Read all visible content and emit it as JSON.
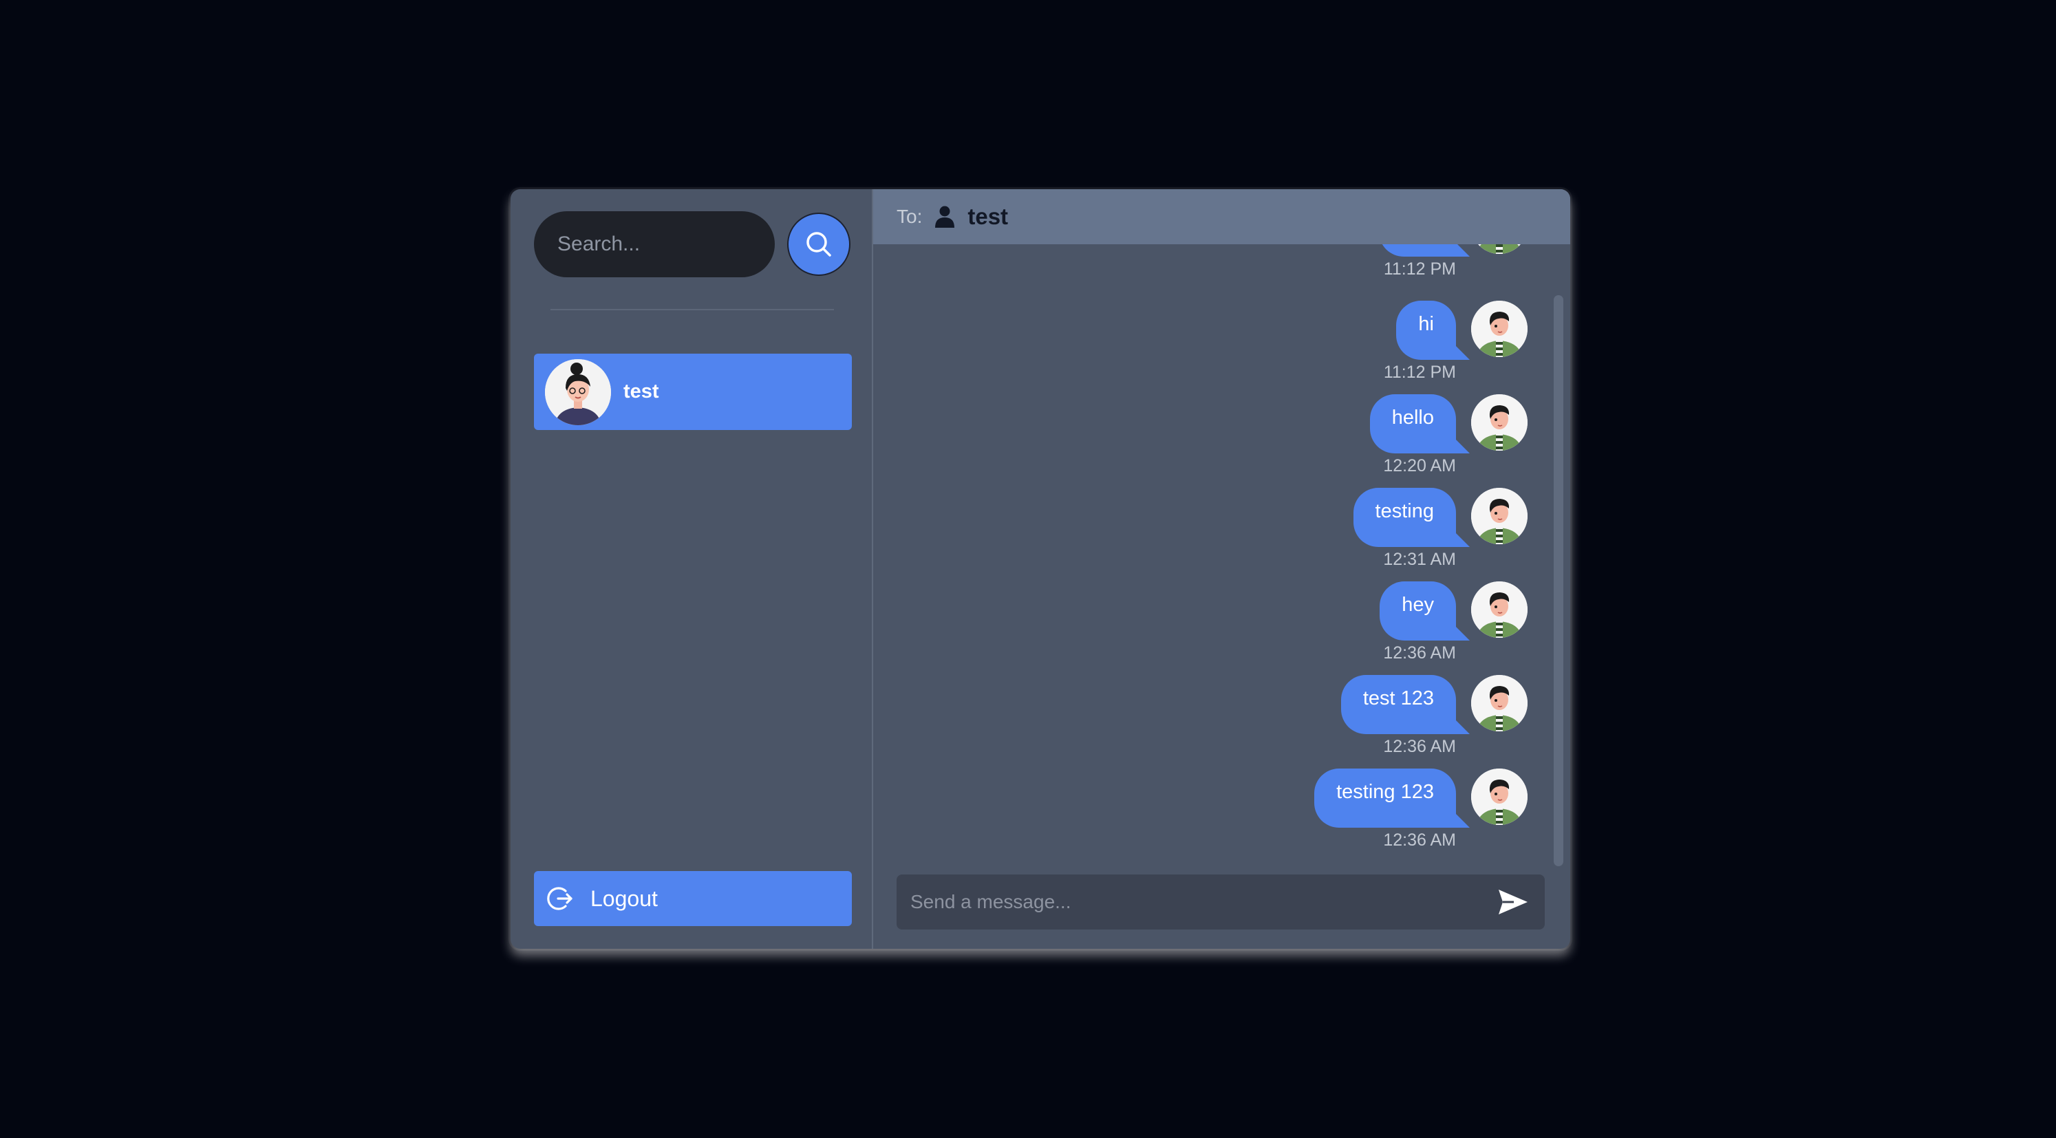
{
  "sidebar": {
    "search": {
      "placeholder": "Search..."
    },
    "conversations": [
      {
        "name": "test",
        "selected": true
      }
    ],
    "logout_label": "Logout"
  },
  "chat": {
    "header": {
      "to_label": "To:",
      "recipient": "test"
    },
    "messages": [
      {
        "text": "",
        "time": "11:12 PM",
        "from_me": true
      },
      {
        "text": "hi",
        "time": "11:12 PM",
        "from_me": true
      },
      {
        "text": "hello",
        "time": "12:20 AM",
        "from_me": true
      },
      {
        "text": "testing",
        "time": "12:31 AM",
        "from_me": true
      },
      {
        "text": "hey",
        "time": "12:36 AM",
        "from_me": true
      },
      {
        "text": "test 123",
        "time": "12:36 AM",
        "from_me": true
      },
      {
        "text": "testing 123",
        "time": "12:36 AM",
        "from_me": true
      }
    ],
    "composer": {
      "placeholder": "Send a message..."
    }
  },
  "colors": {
    "background": "#030611",
    "panel": "#4b5567",
    "header": "#66758e",
    "accent": "#4f83ee",
    "input": "#1f2229"
  },
  "icons": {
    "search": "search-icon",
    "logout": "logout-icon",
    "user": "user-icon",
    "send": "send-icon"
  }
}
